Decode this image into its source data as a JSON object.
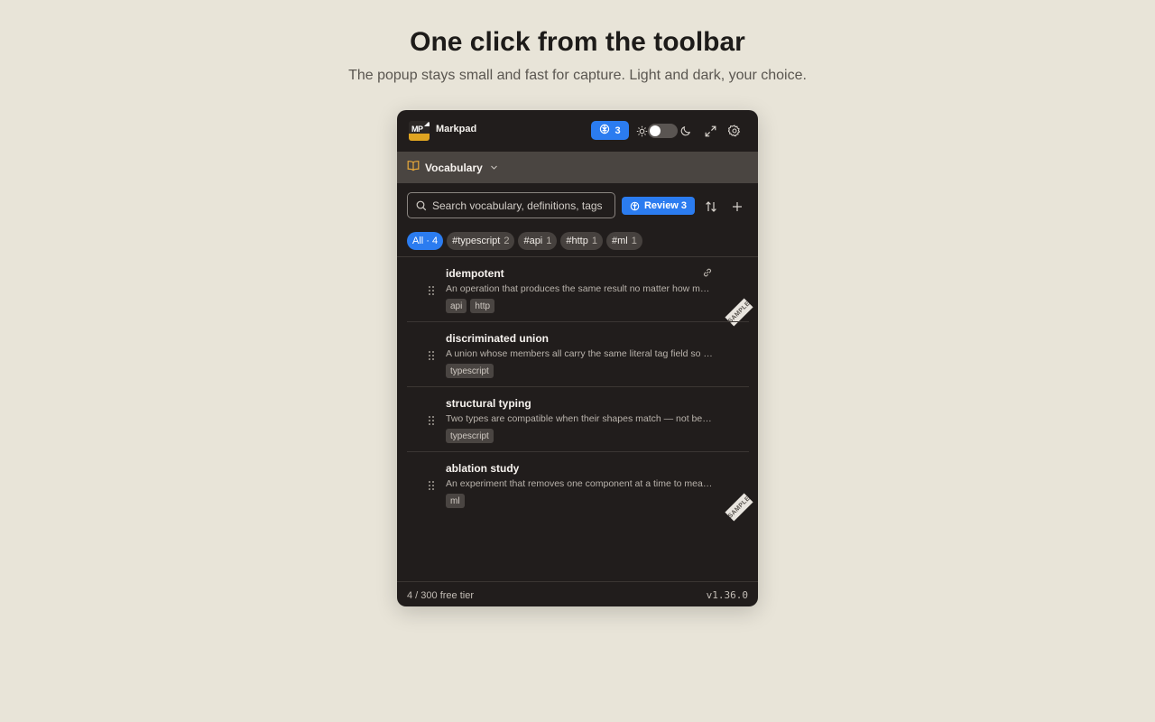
{
  "hero": {
    "title": "One click from the toolbar",
    "subtitle": "The popup stays small and fast for capture. Light and dark, your choice."
  },
  "header": {
    "logo_letters": "MP",
    "app_name": "Markpad",
    "review_count": "3",
    "icons": [
      "review-brain-icon",
      "sun-icon",
      "moon-icon",
      "expand-icon",
      "gear-icon"
    ]
  },
  "section": {
    "label": "Vocabulary",
    "icon": "book-icon"
  },
  "toolbar": {
    "search_placeholder": "Search vocabulary, definitions, tags",
    "review_label": "Review 3"
  },
  "filters": [
    {
      "label": "All · 4",
      "count": "",
      "active": true
    },
    {
      "label": "#typescript",
      "count": "2",
      "active": false
    },
    {
      "label": "#api",
      "count": "1",
      "active": false
    },
    {
      "label": "#http",
      "count": "1",
      "active": false
    },
    {
      "label": "#ml",
      "count": "1",
      "active": false
    }
  ],
  "entries": [
    {
      "term": "idempotent",
      "definition": "An operation that produces the same result no matter how many times it is applied.",
      "tags": [
        "api",
        "http"
      ],
      "sample_label": "SAMPLE"
    },
    {
      "term": "discriminated union",
      "definition": "A union whose members all carry the same literal tag field so the type can be narrowed.",
      "tags": [
        "typescript"
      ]
    },
    {
      "term": "structural typing",
      "definition": "Two types are compatible when their shapes match — not because of their declared names.",
      "tags": [
        "typescript"
      ]
    },
    {
      "term": "ablation study",
      "definition": "An experiment that removes one component at a time to measure its contribution.",
      "tags": [
        "ml"
      ],
      "sample_label": "SAMPLE"
    }
  ],
  "footer": {
    "usage": "4 / 300 free tier",
    "version": "v1.36.0"
  },
  "colors": {
    "accent": "#2b7cf0",
    "popup_bg": "#211d1c",
    "section_bg": "#4a4541",
    "page_bg": "#e8e4d8",
    "logo_stripe": "#e0a521"
  }
}
